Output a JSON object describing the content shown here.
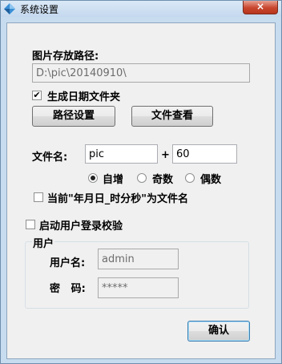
{
  "window": {
    "title": "系统设置",
    "close_label": "×",
    "icon": "diamond-app-icon"
  },
  "storage": {
    "path_label": "图片存放路径:",
    "path_value": "D:\\pic\\20140910\\",
    "date_folder_label": "生成日期文件夹",
    "date_folder_checked": true,
    "path_settings_button": "路径设置",
    "view_files_button": "文件查看"
  },
  "filename": {
    "label": "文件名:",
    "prefix_value": "pic",
    "plus": "+",
    "number_value": "60",
    "radio_options": [
      "自增",
      "奇数",
      "偶数"
    ],
    "radio_selected": "自增",
    "timestamp_label": "当前\"年月日_时分秒\"为文件名",
    "timestamp_checked": false
  },
  "login": {
    "enable_label": "启动用户登录校验",
    "enable_checked": false,
    "group_title": "用户",
    "username_label": "用户名:",
    "username_value": "admin",
    "password_label": "密   码:",
    "password_value": "*****"
  },
  "confirm_button": "确认"
}
